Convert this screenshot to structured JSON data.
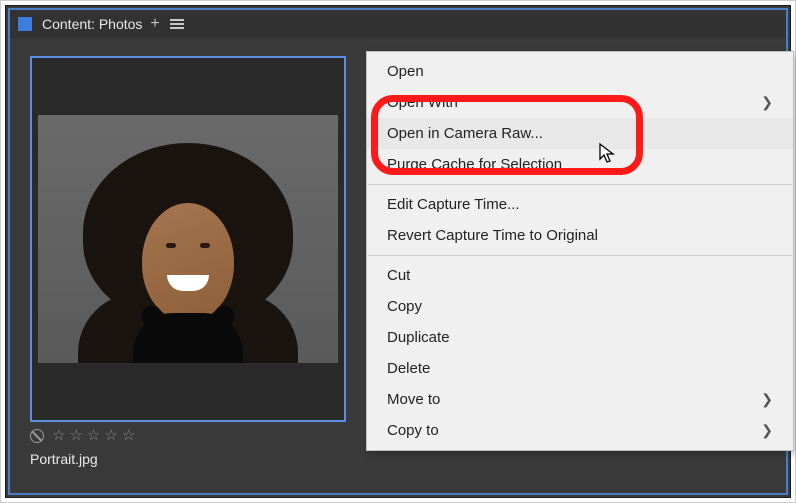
{
  "titlebar": {
    "label": "Content: Photos"
  },
  "thumbnail": {
    "filename": "Portrait.jpg",
    "rating_stars": 5
  },
  "context_menu": {
    "items": [
      {
        "label": "Open",
        "submenu": false,
        "highlighted": false
      },
      {
        "label": "Open With",
        "submenu": true,
        "highlighted": false
      },
      {
        "label": "Open in Camera Raw...",
        "submenu": false,
        "highlighted": true
      },
      {
        "label": "Purge Cache for Selection",
        "submenu": false,
        "highlighted": false
      },
      {
        "sep": true
      },
      {
        "label": "Edit Capture Time...",
        "submenu": false,
        "highlighted": false
      },
      {
        "label": "Revert Capture Time to Original",
        "submenu": false,
        "highlighted": false
      },
      {
        "sep": true
      },
      {
        "label": "Cut",
        "submenu": false,
        "highlighted": false
      },
      {
        "label": "Copy",
        "submenu": false,
        "highlighted": false
      },
      {
        "label": "Duplicate",
        "submenu": false,
        "highlighted": false
      },
      {
        "label": "Delete",
        "submenu": false,
        "highlighted": false
      },
      {
        "label": "Move to",
        "submenu": true,
        "highlighted": false
      },
      {
        "label": "Copy to",
        "submenu": true,
        "highlighted": false
      }
    ]
  }
}
